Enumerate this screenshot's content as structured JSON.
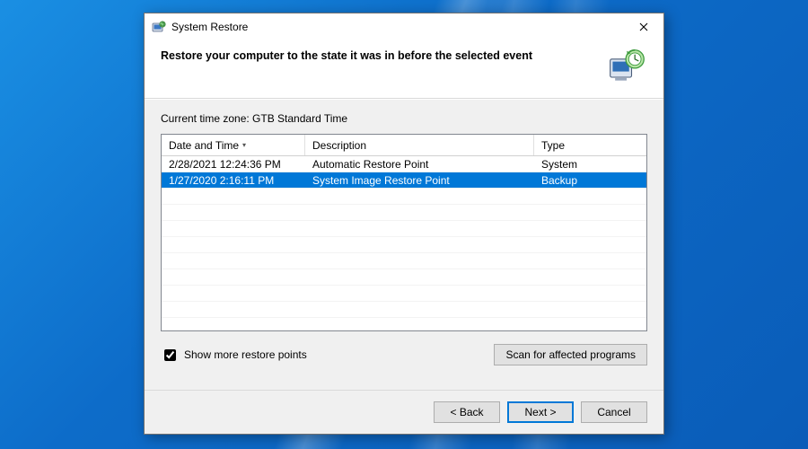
{
  "window": {
    "title": "System Restore"
  },
  "header": {
    "heading": "Restore your computer to the state it was in before the selected event"
  },
  "body": {
    "timezone_label": "Current time zone: GTB Standard Time",
    "columns": {
      "date": "Date and Time",
      "desc": "Description",
      "type": "Type"
    },
    "rows": [
      {
        "date": "2/28/2021 12:24:36 PM",
        "desc": "Automatic Restore Point",
        "type": "System",
        "selected": false
      },
      {
        "date": "1/27/2020 2:16:11 PM",
        "desc": "System Image Restore Point",
        "type": "Backup",
        "selected": true
      }
    ],
    "show_more_label": "Show more restore points",
    "show_more_checked": true,
    "scan_label": "Scan for affected programs"
  },
  "footer": {
    "back": "< Back",
    "next": "Next >",
    "cancel": "Cancel"
  },
  "colors": {
    "selection": "#0078d7",
    "panel": "#f0f0f0"
  }
}
